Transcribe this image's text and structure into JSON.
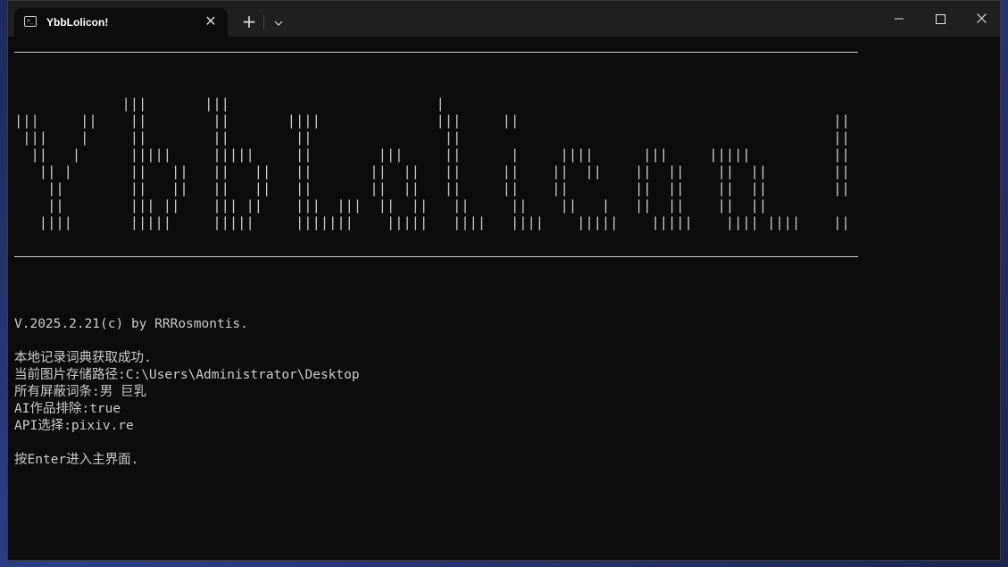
{
  "window": {
    "tab_title": "YbbLolicon!",
    "tab_icon": "terminal-icon",
    "close_tab": "✕",
    "new_tab": "+",
    "dropdown": "⌄",
    "minimize": "—",
    "close_window": "✕"
  },
  "terminal": {
    "banner_lines": [
      "",
      "             |||       |||                         |",
      "|||     ||    ||        ||       ||||              |||     ||                                      ||",
      " |||    |     ||        ||        ||                ||                                             ||",
      "  ||   |      |||||     |||||     ||        |||     ||      |     ||||      |||     |||||          ||",
      "   || |       ||   ||   ||   ||   ||       ||  ||   ||     ||    ||  ||    ||  ||    ||  ||        ||",
      "    ||        ||   ||   ||   ||   ||       ||  ||   ||     ||    ||        ||  ||    ||  ||        ||",
      "    ||        ||| ||    ||| ||    |||  |||  ||  ||   ||     ||    ||   |   ||  ||    ||  ||",
      "   ||||       |||||     |||||     |||||||    |||||   ||||   ||||    |||||    |||||    |||| ||||    ||"
    ],
    "version": "V.2025.2.21(c) by RRRosmontis.",
    "messages": [
      "本地记录词典获取成功.",
      "当前图片存储路径:C:\\Users\\Administrator\\Desktop",
      "所有屏蔽词条:男 巨乳",
      "AI作品排除:true",
      "API选择:pixiv.re"
    ],
    "prompt": "按Enter进入主界面."
  }
}
